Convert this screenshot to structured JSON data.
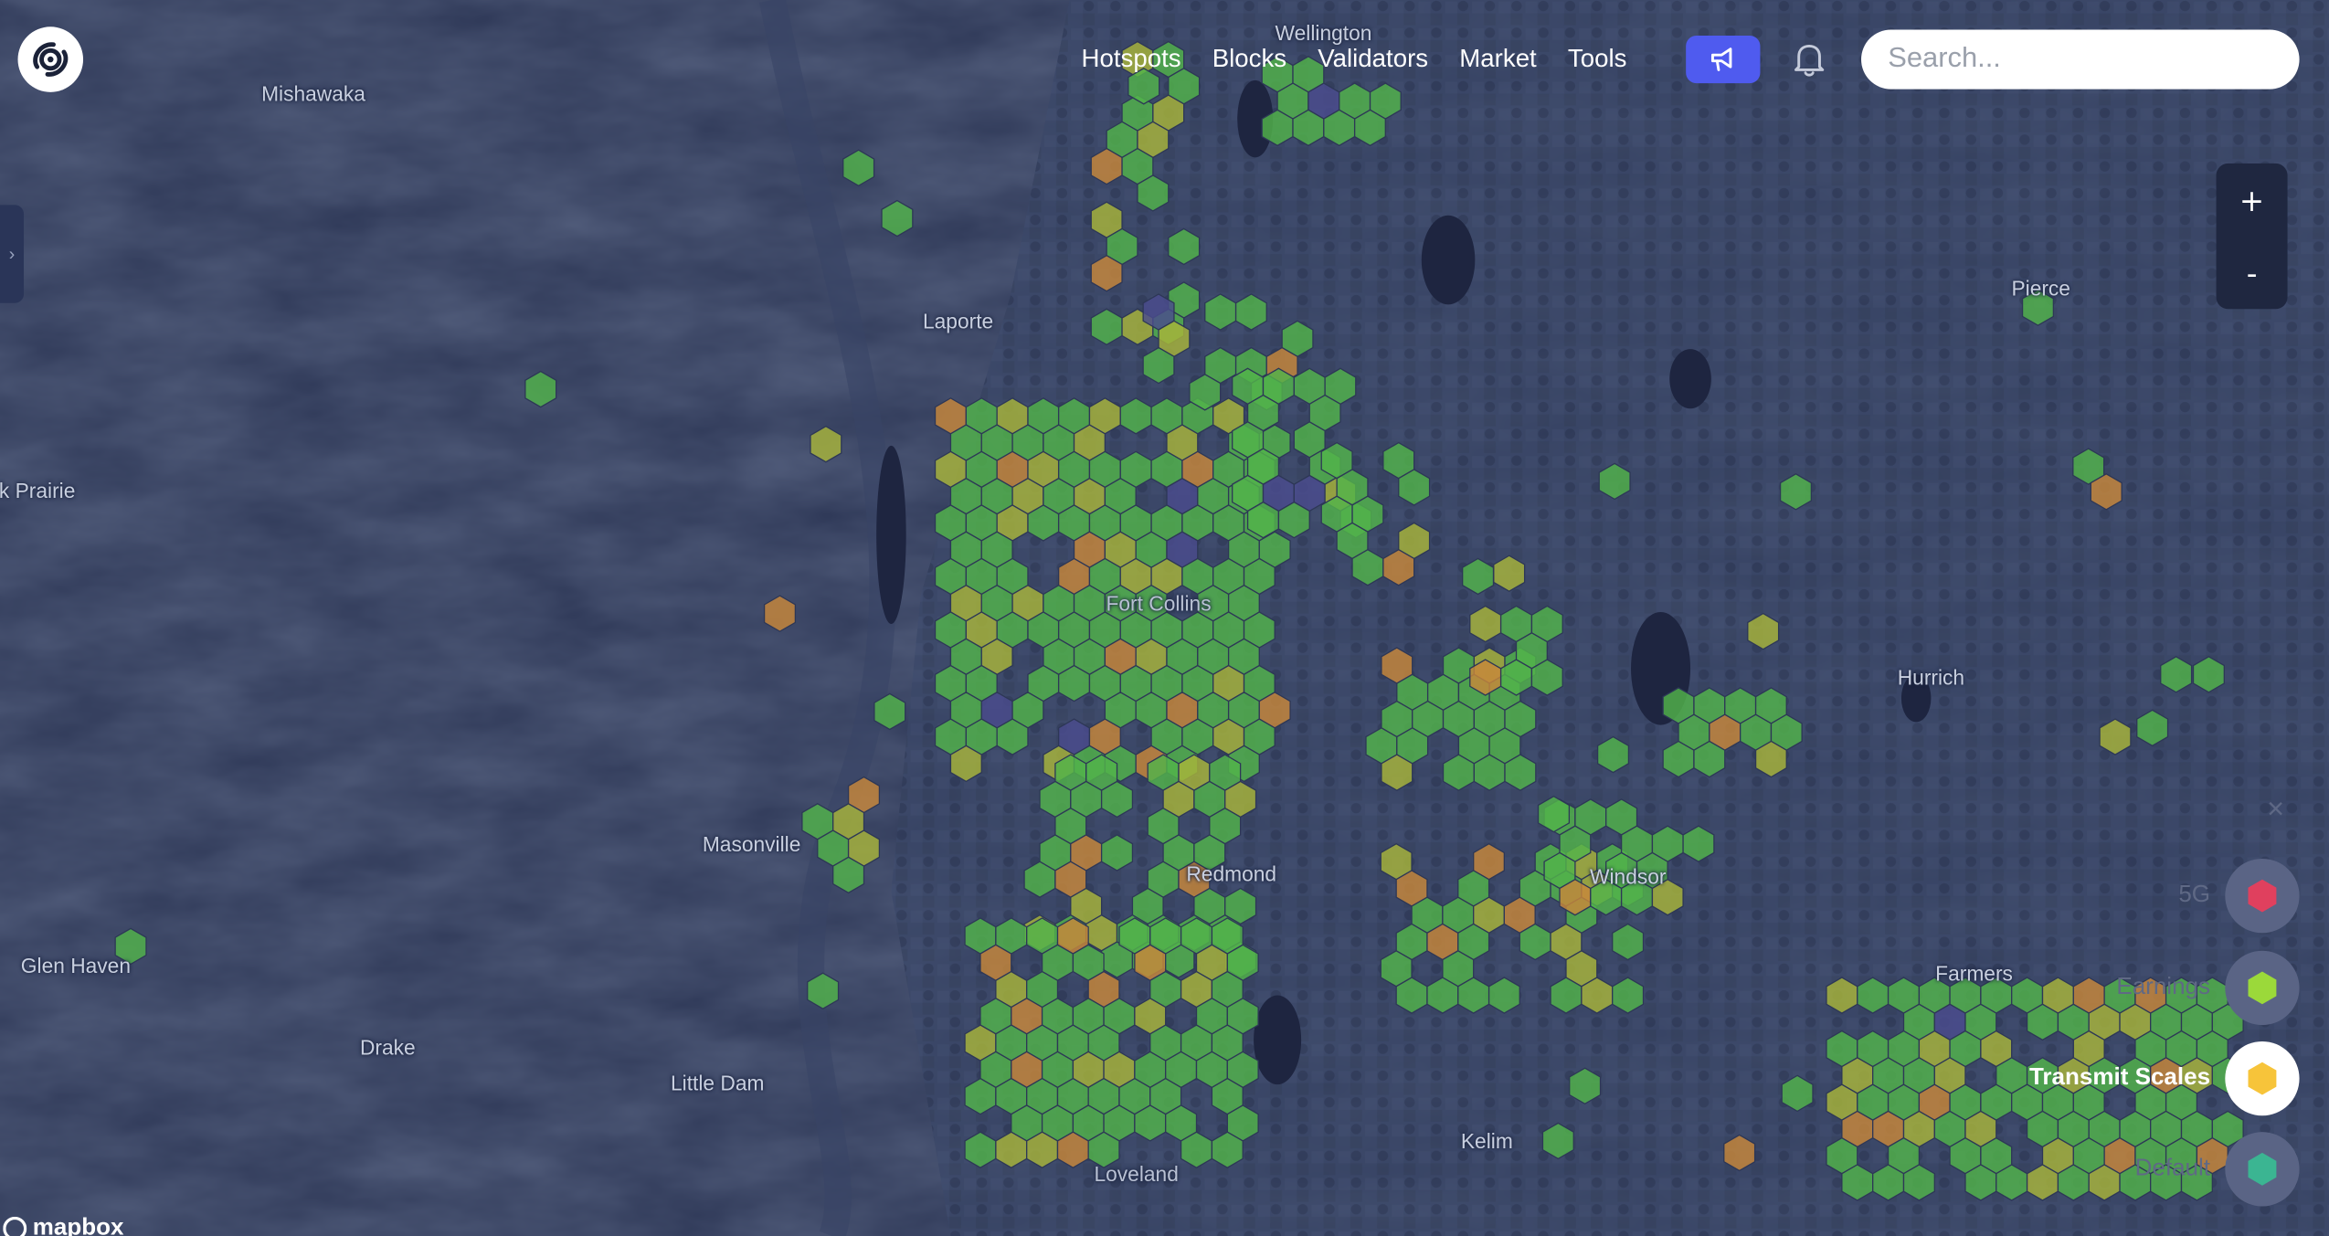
{
  "nav": {
    "items": [
      {
        "label": "Hotspots"
      },
      {
        "label": "Blocks"
      },
      {
        "label": "Validators"
      },
      {
        "label": "Market"
      },
      {
        "label": "Tools"
      }
    ]
  },
  "search": {
    "placeholder": "Search..."
  },
  "zoom": {
    "in_label": "+",
    "out_label": "-"
  },
  "sidebar": {
    "toggle_label": "›"
  },
  "layers": {
    "close_label": "×",
    "items": [
      {
        "label": "5G",
        "color": "#e0405e",
        "active": false
      },
      {
        "label": "Earnings",
        "color": "#9bd93a",
        "active": false
      },
      {
        "label": "Transmit Scales",
        "color": "#f7c43a",
        "active": true
      },
      {
        "label": "Default",
        "color": "#3bb592",
        "active": false
      }
    ]
  },
  "map": {
    "places": [
      {
        "label": "Wellington"
      },
      {
        "label": "Mishawaka"
      },
      {
        "label": "Laporte"
      },
      {
        "label": "k Prairie"
      },
      {
        "label": "Fort Collins"
      },
      {
        "label": "Masonville"
      },
      {
        "label": "Redmond"
      },
      {
        "label": "Windsor"
      },
      {
        "label": "Glen Haven"
      },
      {
        "label": "Drake"
      },
      {
        "label": "Little Dam"
      },
      {
        "label": "Kelim"
      },
      {
        "label": "Loveland"
      },
      {
        "label": "Pierce"
      },
      {
        "label": "Hurrich"
      },
      {
        "label": "Farmers"
      }
    ],
    "hex_colors": {
      "green": "#52b34a",
      "yellow": "#a8b43a",
      "orange": "#c8873a",
      "purple": "#4a4c8e"
    }
  },
  "attribution": {
    "label": "mapbox"
  }
}
